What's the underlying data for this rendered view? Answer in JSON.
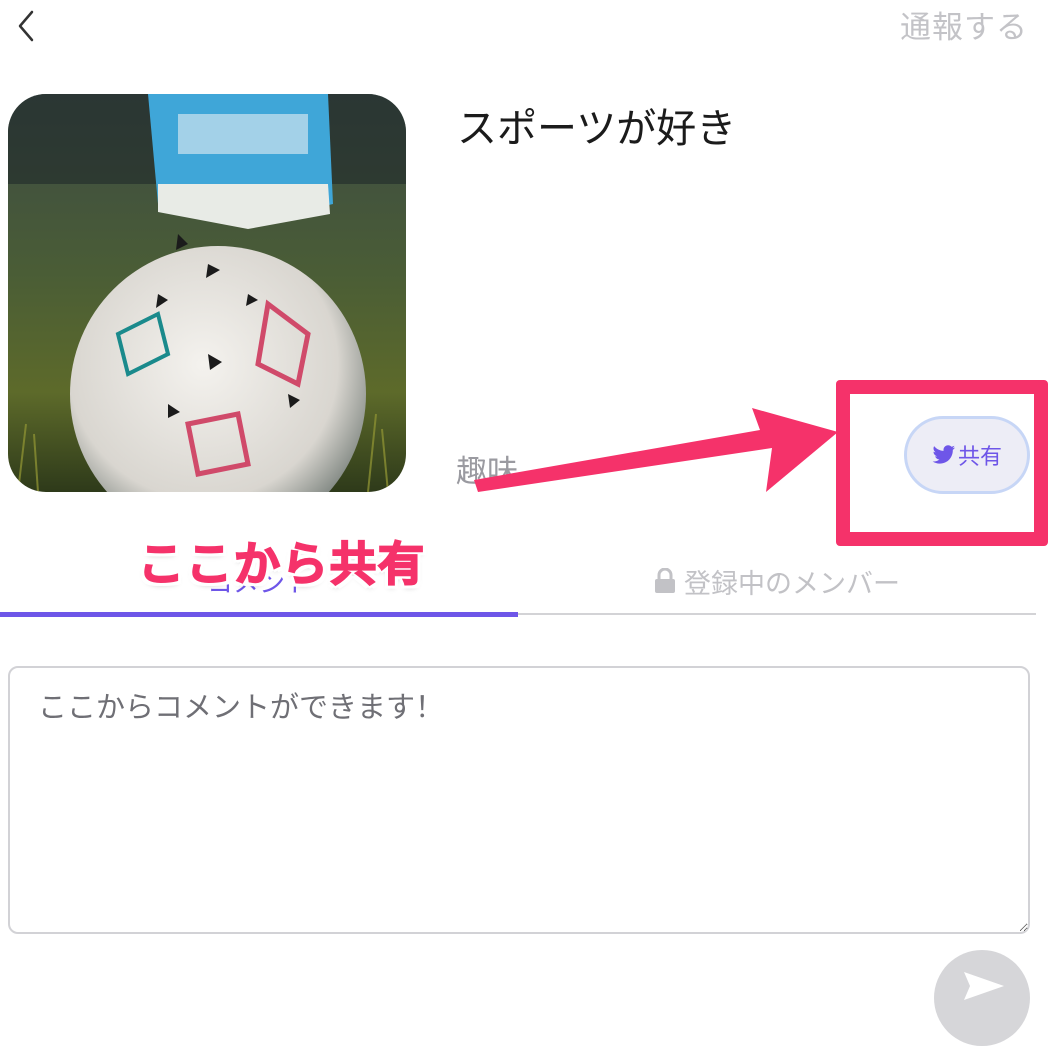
{
  "header": {
    "back_icon": "chevron-left-icon",
    "report_label": "通報する"
  },
  "community": {
    "image_alt": "soccer-ball-photo",
    "title": "スポーツが好き",
    "category": "趣味",
    "share_icon": "twitter-bird-icon",
    "share_label": "共有"
  },
  "annotation": {
    "text": "ここから共有",
    "color": "#f5326a"
  },
  "tabs": [
    {
      "label": "コメント",
      "active": true
    },
    {
      "label": "登録中のメンバー",
      "icon": "lock-icon",
      "active": false
    }
  ],
  "comment": {
    "placeholder": "ここからコメントができます！"
  },
  "send": {
    "icon": "send-icon"
  },
  "colors": {
    "accent": "#6e56e8",
    "muted": "#c2c2c6",
    "annotation": "#f5326a"
  }
}
